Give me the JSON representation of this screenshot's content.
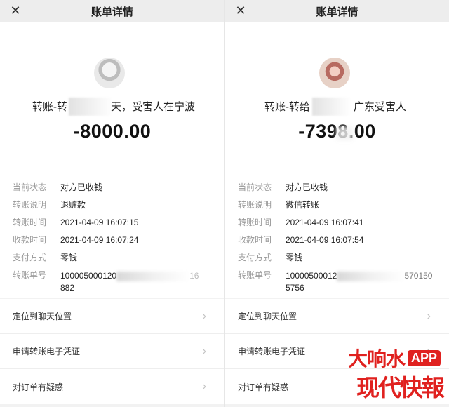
{
  "screens": [
    {
      "close_glyph": "✕",
      "title": "账单详情",
      "avatar_icon": "user-avatar-icon",
      "title_left": "转账-转",
      "title_right": "天，受害人在宁波",
      "amount": "-8000.00",
      "details": [
        {
          "label": "当前状态",
          "value": "对方已收钱"
        },
        {
          "label": "转账说明",
          "value": "退赃款"
        },
        {
          "label": "转账时间",
          "value": "2021-04-09 16:07:15"
        },
        {
          "label": "收款时间",
          "value": "2021-04-09 16:07:24"
        },
        {
          "label": "支付方式",
          "value": "零钱"
        }
      ],
      "order": {
        "label": "转账单号",
        "value_start": "100005000120",
        "value_end": "16",
        "value_line2": "882"
      },
      "menu": [
        "定位到聊天位置",
        "申请转账电子凭证",
        "对订单有疑惑"
      ],
      "chevron": "›"
    },
    {
      "close_glyph": "✕",
      "title": "账单详情",
      "avatar_icon": "user-avatar-icon",
      "title_left": "转账-转给",
      "title_right": "广东受害人",
      "amount": "-7398.00",
      "details": [
        {
          "label": "当前状态",
          "value": "对方已收钱"
        },
        {
          "label": "转账说明",
          "value": "微信转账"
        },
        {
          "label": "转账时间",
          "value": "2021-04-09 16:07:41"
        },
        {
          "label": "收款时间",
          "value": "2021-04-09 16:07:54"
        },
        {
          "label": "支付方式",
          "value": "零钱"
        }
      ],
      "order": {
        "label": "转账单号",
        "value_start": "10000500012",
        "value_end": "570150",
        "value_line2": "5756"
      },
      "menu": [
        "定位到聊天位置",
        "申请转账电子凭证",
        "对订单有疑惑"
      ],
      "chevron": "›"
    }
  ],
  "watermark": {
    "line1": "大响水",
    "app": "APP",
    "line2": "现代快報"
  },
  "colors": {
    "brand_red": "#e0211f",
    "label_gray": "#999999",
    "page_bg": "#f2f2f2"
  }
}
